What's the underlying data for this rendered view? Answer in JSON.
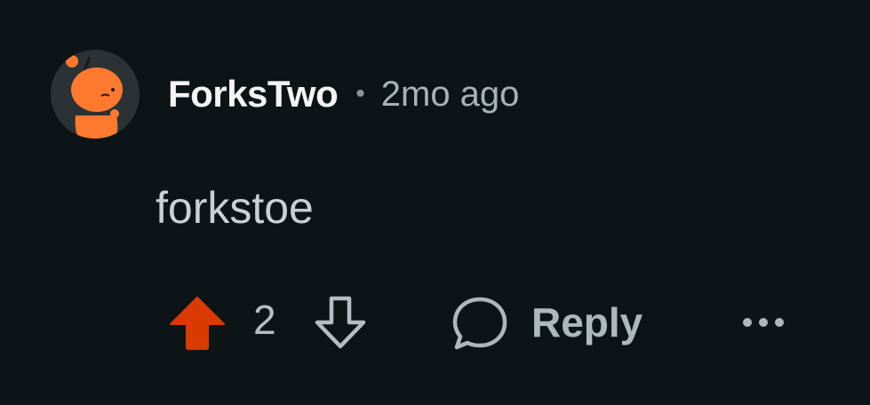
{
  "comment": {
    "author": "ForksTwo",
    "separator": "•",
    "timestamp": "2mo ago",
    "body": "forkstoe",
    "score": "2",
    "upvoted": true,
    "reply_label": "Reply"
  },
  "colors": {
    "background": "#0d1416",
    "upvote_active": "#d93a00",
    "avatar_orange": "#ff7a2f",
    "text_primary": "#f2f4f5",
    "text_secondary": "#a8b3b7"
  },
  "icons": {
    "avatar": "snoo-avatar",
    "upvote": "upvote-arrow-filled",
    "downvote": "downvote-arrow-outline",
    "reply": "speech-bubble",
    "more": "ellipsis-horizontal"
  }
}
